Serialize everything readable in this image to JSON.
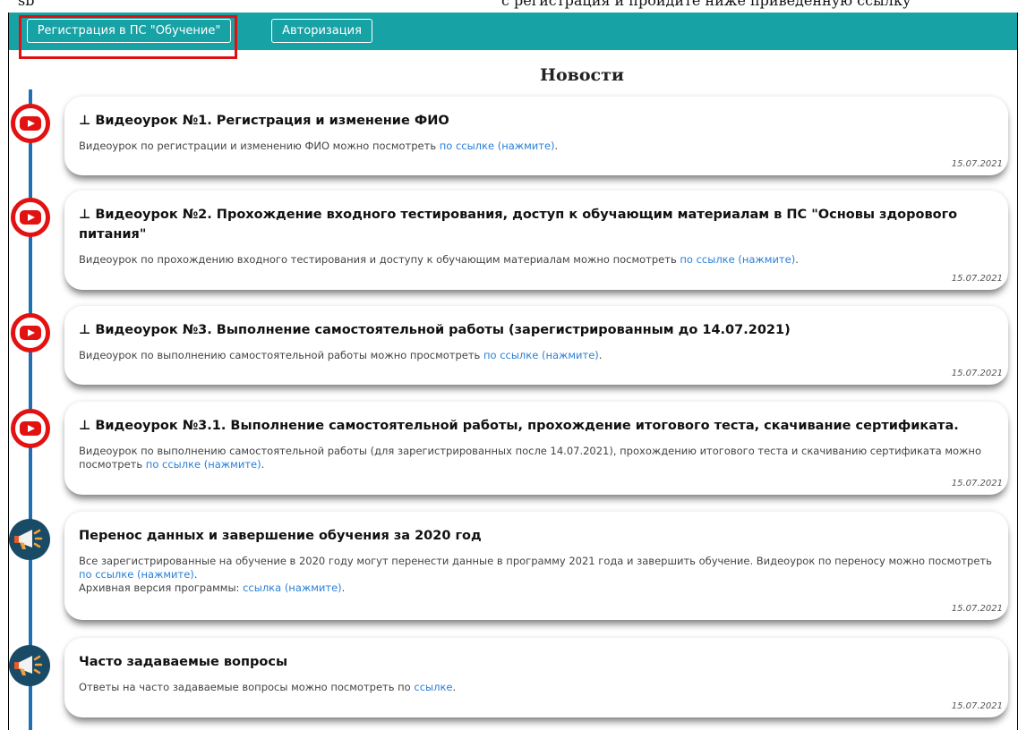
{
  "overlay_text": {
    "left": "sb",
    "right": "с регистрация и пройдите ниже приведённую ссылку"
  },
  "header": {
    "register_button": "Регистрация в ПС \"Обучение\"",
    "auth_button": "Авторизация"
  },
  "page_title": "Новости",
  "news": [
    {
      "icon": "youtube-icon",
      "pinned": true,
      "title": "Видеоурок №1. Регистрация и изменение ФИО",
      "text_before": "Видеоурок по регистрации и изменению ФИО можно посмотреть ",
      "link": "по ссылке (нажмите)",
      "text_after": ".",
      "date": "15.07.2021"
    },
    {
      "icon": "youtube-icon",
      "pinned": true,
      "title": "Видеоурок №2. Прохождение входного тестирования, доступ к обучающим материалам в ПС \"Основы здорового питания\"",
      "text_before": "Видеоурок по прохождению входного тестирования и доступу к обучающим материалам можно посмотреть ",
      "link": "по ссылке (нажмите)",
      "text_after": ".",
      "date": "15.07.2021"
    },
    {
      "icon": "youtube-icon",
      "pinned": true,
      "title": "Видеоурок №3. Выполнение самостоятельной работы (зарегистрированным до 14.07.2021)",
      "text_before": "Видеоурок по выполнению самостоятельной работы можно просмотреть ",
      "link": "по ссылке (нажмите)",
      "text_after": ".",
      "date": "15.07.2021"
    },
    {
      "icon": "youtube-icon",
      "pinned": true,
      "title": "Видеоурок №3.1. Выполнение самостоятельной работы, прохождение итогового теста, скачивание сертификата.",
      "text_before": "Видеоурок по выполнению самостоятельной работы (для зарегистрированных после 14.07.2021), прохождению итогового теста и скачиванию сертификата можно посмотреть ",
      "link": "по ссылке (нажмите)",
      "text_after": ".",
      "date": "15.07.2021"
    },
    {
      "icon": "megaphone-icon",
      "pinned": false,
      "title": "Перенос данных и завершение обучения за 2020 год",
      "text_before": "Все зарегистрированные на обучение в 2020 году могут перенести данные в программу 2021 года и завершить обучение. Видеоурок по переносу можно посмотреть ",
      "link": "по ссылке (нажмите)",
      "text_after": ".",
      "extra_before": "Архивная версия программы: ",
      "extra_link": "ссылка (нажмите)",
      "extra_after": ".",
      "date": "15.07.2021"
    },
    {
      "icon": "megaphone-icon",
      "pinned": false,
      "title": "Часто задаваемые вопросы",
      "text_before": "Ответы на часто задаваемые вопросы можно посмотреть по ",
      "link": "ссылке",
      "text_after": ".",
      "date": "15.07.2021"
    }
  ],
  "colors": {
    "header_bg": "#17a2a5",
    "timeline": "#1f6fb2",
    "youtube_red": "#e31212",
    "megaphone_bg": "#1a4b66",
    "link": "#2b7fd6",
    "highlight": "#e01010"
  }
}
